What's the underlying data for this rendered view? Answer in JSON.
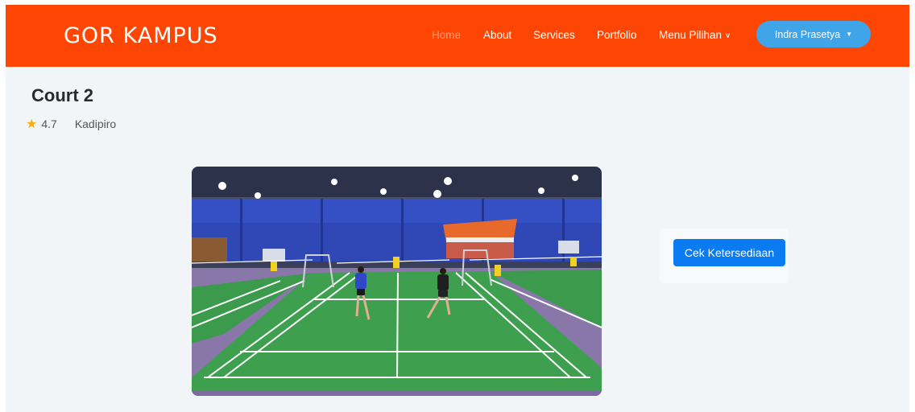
{
  "navbar": {
    "brand": "GOR KAMPUS",
    "links": [
      {
        "label": "Home",
        "active": true
      },
      {
        "label": "About"
      },
      {
        "label": "Services"
      },
      {
        "label": "Portfolio"
      },
      {
        "label": "Menu Pilihan",
        "icon": "chevron-down-icon"
      }
    ],
    "user_button": {
      "label": "Indra Prasetya",
      "icon": "caret-down-icon"
    }
  },
  "court": {
    "name": "Court 2",
    "rating": "4.7",
    "rating_icon": "star-icon",
    "location": "Kadipiro"
  },
  "actions": {
    "check_availability": "Cek Ketersediaan"
  },
  "colors": {
    "navbar": "#fd4603",
    "active_link": "#ff9a75",
    "user_button": "#3fa5e8",
    "primary_button": "#0b7bf2",
    "star": "#f5b10f"
  }
}
